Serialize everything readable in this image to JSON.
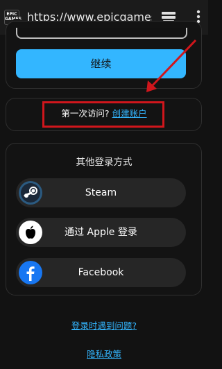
{
  "browser": {
    "url": "https://www.epicgames.c",
    "site_icon_text": "EPIC GAMES"
  },
  "form": {
    "continue_label": "继续"
  },
  "signup": {
    "prompt": "第一次访问?",
    "link": "创建账户"
  },
  "other_login": {
    "title": "其他登录方式",
    "buttons": [
      {
        "label": "Steam"
      },
      {
        "label": "通过 Apple 登录"
      },
      {
        "label": "Facebook"
      }
    ]
  },
  "footer": {
    "help_link": "登录时遇到问题?",
    "privacy_link": "隐私政策"
  },
  "colors": {
    "accent": "#33b6ff",
    "annotation_red": "#d0161c",
    "background": "#121212"
  }
}
